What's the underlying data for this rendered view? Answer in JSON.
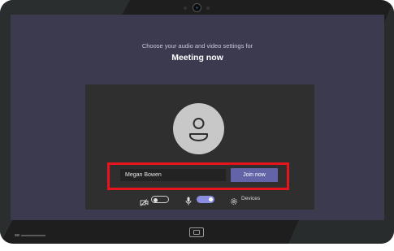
{
  "prejoin": {
    "prompt": "Choose your audio and video settings for",
    "meeting_title": "Meeting now"
  },
  "name_field": {
    "value": "Megan Bowen"
  },
  "join_button": {
    "label": "Join now"
  },
  "controls": {
    "camera_icon": "camera-off-icon",
    "camera_state": "off",
    "mic_icon": "microphone-icon",
    "mic_state": "on",
    "devices_icon": "gear-icon",
    "devices_label": "Devices"
  },
  "colors": {
    "screen_background": "#3b3a4f",
    "panel_background": "#2f2f2f",
    "join_button": "#6264a7",
    "toggle_on": "#8b8de0",
    "highlight_box": "#e8141c"
  }
}
